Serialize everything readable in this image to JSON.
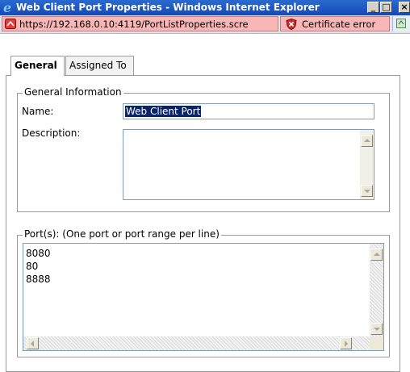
{
  "window": {
    "title": "Web Client Port Properties - Windows Internet Explorer",
    "minimize_glyph": "_",
    "maximize_glyph": "□",
    "close_glyph": "×"
  },
  "addressbar": {
    "url": "https://192.168.0.10:4119/PortListProperties.scre",
    "cert_error": "Certificate error"
  },
  "tabs": [
    {
      "label": "General",
      "active": true
    },
    {
      "label": "Assigned To",
      "active": false
    }
  ],
  "general_info": {
    "legend": "General Information",
    "name_label": "Name:",
    "name_value": "Web Client Port",
    "description_label": "Description:",
    "description_value": ""
  },
  "ports": {
    "legend": "Port(s): (One port or port range per line)",
    "lines": [
      "8080",
      "80",
      "8888"
    ],
    "text": "8080\n80\n8888"
  },
  "colors": {
    "titlebar": "#1f5cc7",
    "error_field": "#f7b7b7",
    "selection": "#0a246a"
  }
}
